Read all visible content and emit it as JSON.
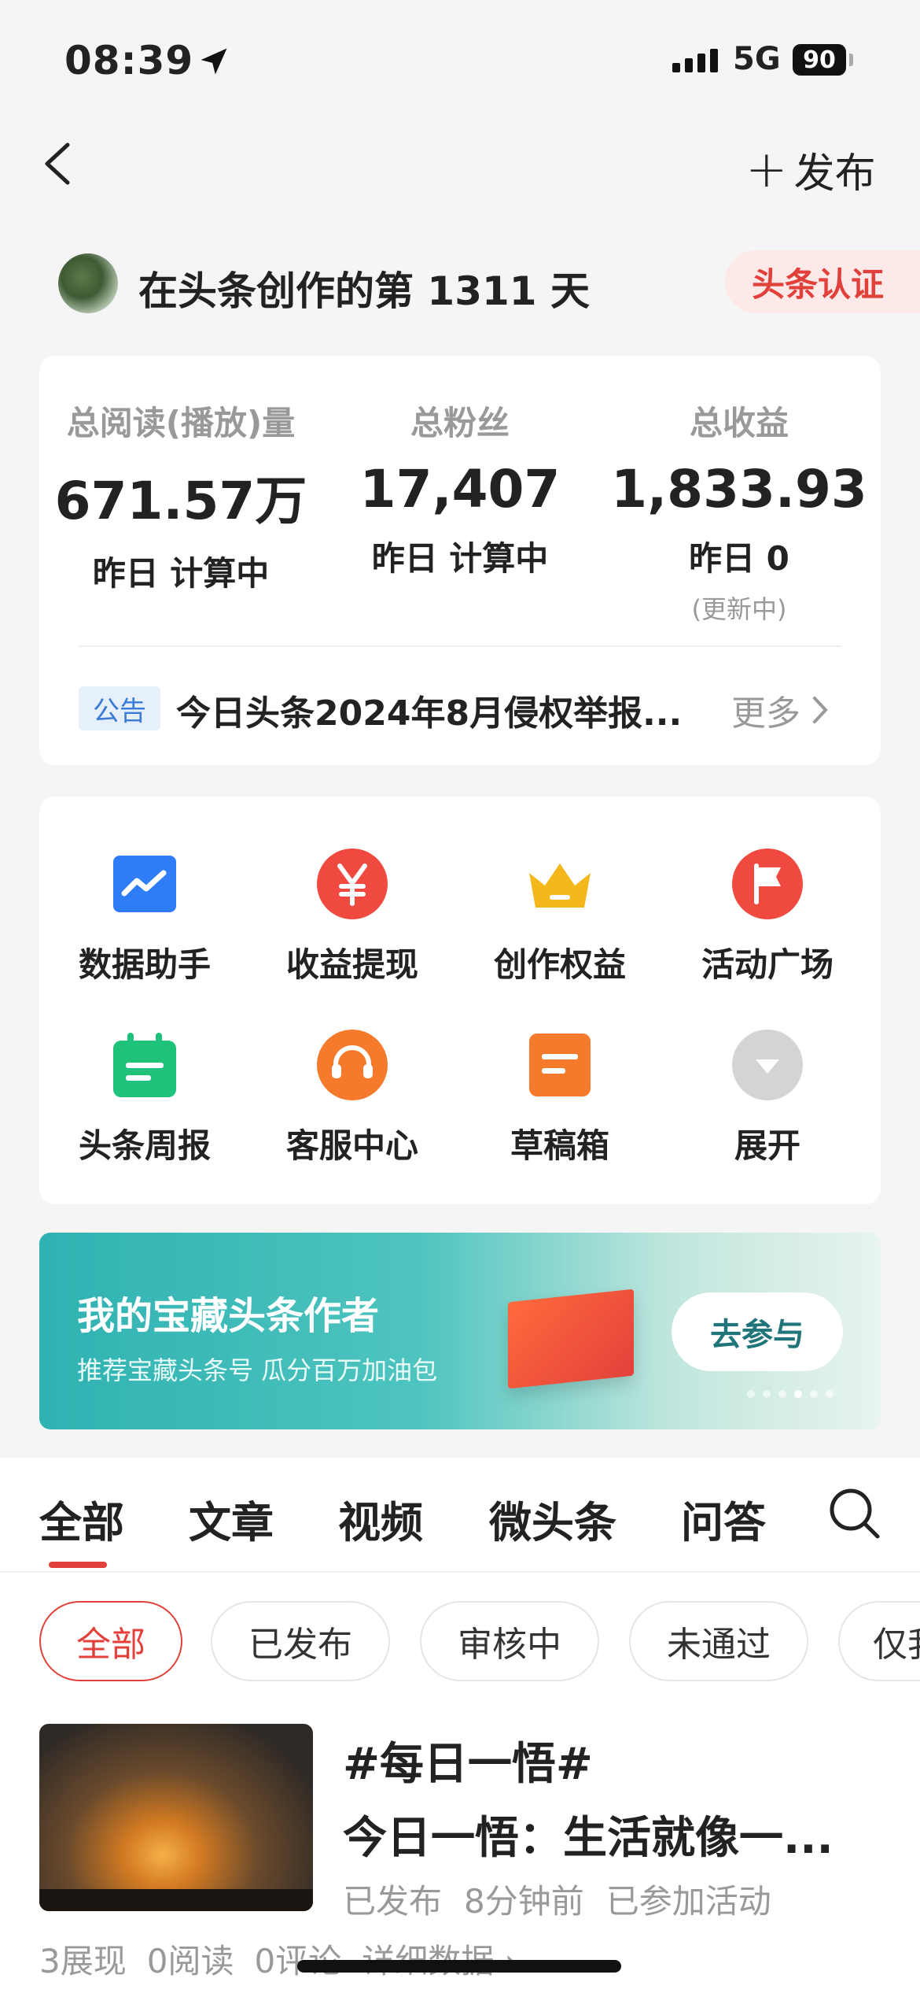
{
  "status_bar": {
    "time": "08:39",
    "network": "5G",
    "battery": "90"
  },
  "nav": {
    "publish_label": "发布"
  },
  "creator": {
    "days_text": "在头条创作的第 1311 天",
    "cert_label": "头条认证"
  },
  "stats": [
    {
      "label": "总阅读(播放)量",
      "value": "671.57万",
      "sub": "昨日 计算中",
      "sub2": ""
    },
    {
      "label": "总粉丝",
      "value": "17,407",
      "sub": "昨日 计算中",
      "sub2": ""
    },
    {
      "label": "总收益",
      "value": "1,833.93",
      "sub": "昨日 0",
      "sub2": "(更新中)"
    }
  ],
  "notice": {
    "tag": "公告",
    "text": "今日头条2024年8月侵权举报...",
    "more": "更多"
  },
  "tools": [
    {
      "label": "数据助手",
      "icon": "chart-icon",
      "color": "#2f7df6"
    },
    {
      "label": "收益提现",
      "icon": "yen-icon",
      "color": "#f04a40"
    },
    {
      "label": "创作权益",
      "icon": "crown-icon",
      "color": "#f5b81c"
    },
    {
      "label": "活动广场",
      "icon": "flag-icon",
      "color": "#f04a40"
    },
    {
      "label": "头条周报",
      "icon": "calendar-icon",
      "color": "#1fc27a"
    },
    {
      "label": "客服中心",
      "icon": "headset-icon",
      "color": "#f57a2c"
    },
    {
      "label": "草稿箱",
      "icon": "draft-icon",
      "color": "#f57a2c"
    },
    {
      "label": "展开",
      "icon": "expand-icon",
      "color": "#cfcfcf"
    }
  ],
  "banner": {
    "title": "我的宝藏头条作者",
    "subtitle": "推荐宝藏头条号  瓜分百万加油包",
    "button": "去参与"
  },
  "tabs": [
    "全部",
    "文章",
    "视频",
    "微头条",
    "问答"
  ],
  "filters": [
    "全部",
    "已发布",
    "审核中",
    "未通过",
    "仅我"
  ],
  "post": {
    "tag": "#每日一悟#",
    "title": "今日一悟：生活就像一...",
    "meta": [
      "已发布",
      "8分钟前",
      "已参加活动"
    ],
    "stats": [
      "3展现",
      "0阅读",
      "0评论",
      "详细数据 ›"
    ]
  }
}
